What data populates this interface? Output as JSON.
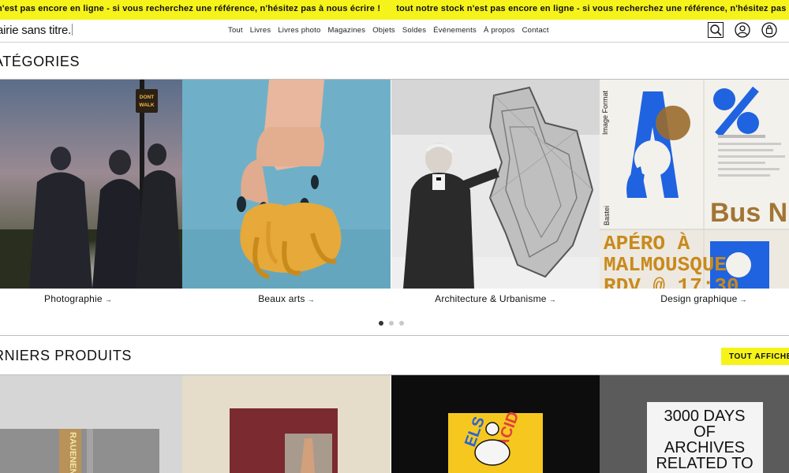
{
  "banner": {
    "messages": [
      "n'est pas encore en ligne - si vous recherchez une référence, n'hésitez pas à nous écrire !",
      "tout notre stock n'est pas encore en ligne - si vous recherchez une référence, n'hésitez pas à nous écrire !"
    ],
    "color": "#f6f31a"
  },
  "header": {
    "logo": "airie sans titre.",
    "nav": [
      "Tout",
      "Livres",
      "Livres photo",
      "Magazines",
      "Objets",
      "Soldes",
      "Événements",
      "À propos",
      "Contact"
    ],
    "icons": [
      "search-icon",
      "user-icon",
      "bag-icon"
    ]
  },
  "categories": {
    "title": "ATÉGORIES",
    "items": [
      {
        "label": "Photographie",
        "arrow": "→"
      },
      {
        "label": "Beaux arts",
        "arrow": "→"
      },
      {
        "label": "Architecture & Urbanisme",
        "arrow": "→"
      },
      {
        "label": "Design graphique",
        "arrow": "→"
      }
    ],
    "carousel": {
      "pages": 3,
      "active": 1
    },
    "poster_text": {
      "image_format": "Image Format",
      "bastei": "Bastei",
      "bus": "Bus N",
      "apero": "APÉRO À",
      "malmousque": "MALMOUSQUE",
      "rdv": "RDV @ 17:30"
    },
    "photo_sign": {
      "line1": "DONT",
      "line2": "WALK"
    }
  },
  "products": {
    "title": "RNIERS PRODUITS",
    "view_all": "TOUT AFFICHER",
    "covers": {
      "spine": "RAUENEN",
      "magazine": "ACID",
      "magazine_side": "ELS",
      "archive_line1": "3000 DAYS",
      "archive_line2": "OF",
      "archive_line3": "ARCHIVES",
      "archive_line4": "RELATED TO"
    }
  }
}
